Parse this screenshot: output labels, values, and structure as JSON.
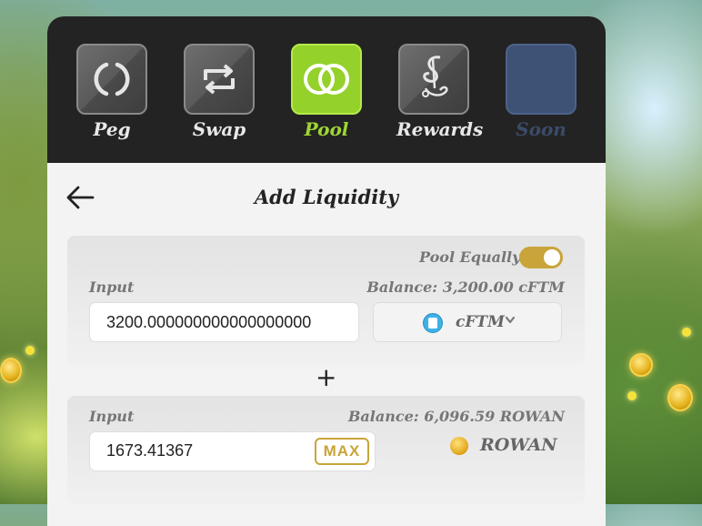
{
  "nav": {
    "items": [
      {
        "label": "Peg",
        "icon": "peg-icon",
        "state": "default"
      },
      {
        "label": "Swap",
        "icon": "swap-icon",
        "state": "default"
      },
      {
        "label": "Pool",
        "icon": "pool-icon",
        "state": "active"
      },
      {
        "label": "Rewards",
        "icon": "rewards-icon",
        "state": "default"
      },
      {
        "label": "Soon",
        "icon": "",
        "state": "disabled"
      }
    ]
  },
  "header": {
    "title": "Add Liquidity",
    "back_icon": "arrow-left-icon"
  },
  "pool_equally": {
    "label": "Pool Equally",
    "enabled": true
  },
  "token_a": {
    "input_label": "Input",
    "balance": "Balance: 3,200.00 cFTM",
    "value": "3200.000000000000000000",
    "symbol": "cFTM"
  },
  "plus_symbol": "+",
  "token_b": {
    "input_label": "Input",
    "balance": "Balance: 6,096.59 ROWAN",
    "value": "1673.41367",
    "max_label": "MAX",
    "symbol": "ROWAN"
  },
  "colors": {
    "nav_bg": "#232323",
    "active": "#95d12b",
    "accent_gold": "#c9a43a",
    "soon": "#3e5276"
  }
}
